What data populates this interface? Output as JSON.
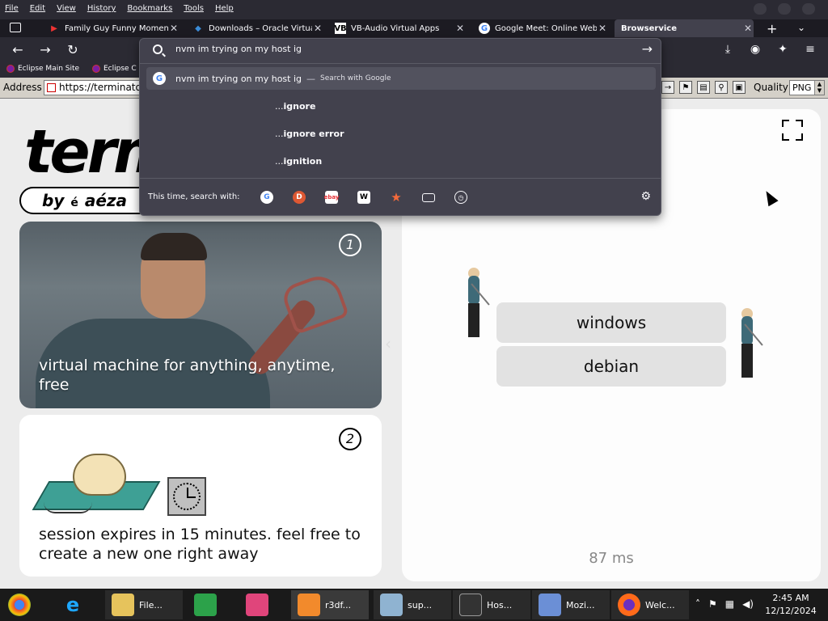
{
  "menubar": {
    "items": [
      "File",
      "Edit",
      "View",
      "History",
      "Bookmarks",
      "Tools",
      "Help"
    ]
  },
  "tabs": [
    {
      "title": "Family Guy Funny Moment",
      "icon": "youtube-icon"
    },
    {
      "title": "Downloads – Oracle Virtual",
      "icon": "virtualbox-icon"
    },
    {
      "title": "VB-Audio Virtual Apps",
      "icon": "vb-audio-icon"
    },
    {
      "title": "Google Meet: Online Web a",
      "icon": "google-icon"
    },
    {
      "title": "Browservice",
      "icon": "",
      "active": true
    }
  ],
  "bookmarks": [
    {
      "label": "Eclipse Main Site"
    },
    {
      "label": "Eclipse C"
    }
  ],
  "browservice": {
    "address_label": "Address",
    "address_value": "https://terminator",
    "quality_label": "Quality",
    "quality_value": "PNG"
  },
  "urlbar": {
    "query": "nvm im trying on my host ig",
    "suggestions": [
      {
        "prefix": "nvm im trying on my host ig",
        "hint": "Search with Google",
        "selected": true
      },
      {
        "prefix": "... ",
        "bold": "ignore"
      },
      {
        "prefix": "... ",
        "bold": "ignore error"
      },
      {
        "prefix": "... ",
        "bold": "ignition"
      }
    ],
    "footer_label": "This time, search with:",
    "engines": [
      "google-icon",
      "duckduckgo-icon",
      "ebay-icon",
      "wikipedia-icon",
      "bookmarks-star-icon",
      "tabs-icon",
      "history-icon"
    ]
  },
  "page": {
    "logo_text": "terminator",
    "byline_by": "by",
    "byline_e": "é",
    "byline_brand": "aéza",
    "card1": {
      "number": "1",
      "caption": "virtual machine for anything, anytime, free"
    },
    "card2": {
      "number": "2",
      "caption": "session expires in 15 minutes. feel free to create a new one right away"
    },
    "os_options": [
      "windows",
      "debian"
    ],
    "latency": "87 ms"
  },
  "taskbar": {
    "apps": [
      {
        "label": "File...",
        "icon": "file-explorer-icon"
      },
      {
        "label": "r3df...",
        "icon": "firefox-dev-icon",
        "active": true
      },
      {
        "label": "sup...",
        "icon": "bird-icon"
      },
      {
        "label": "Hos...",
        "icon": "terminal-icon"
      },
      {
        "label": "Mozi...",
        "icon": "installer-icon"
      },
      {
        "label": "Welc...",
        "icon": "firefox-icon"
      }
    ],
    "time": "2:45 AM",
    "date": "12/12/2024"
  }
}
